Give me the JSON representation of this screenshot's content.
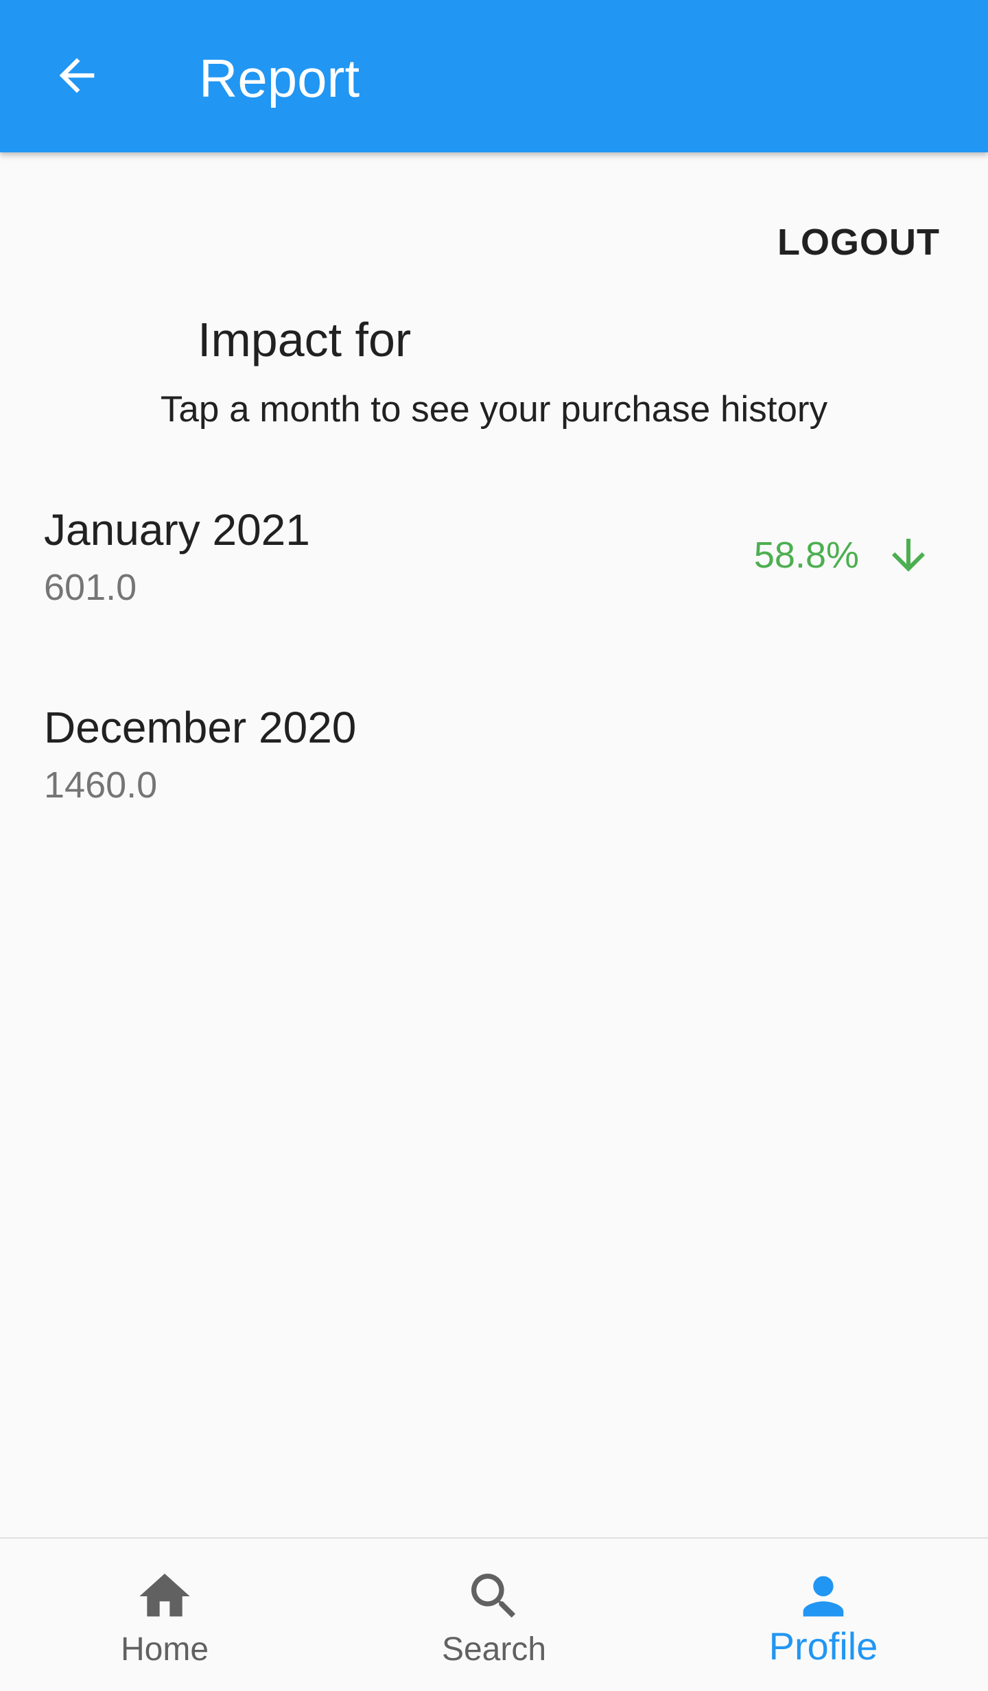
{
  "appbar": {
    "title": "Report",
    "back_icon": "arrow-back-icon",
    "color": "#2196f3"
  },
  "logout_label": "LOGOUT",
  "impact": {
    "title": "Impact for",
    "subtitle": "Tap a month to see your purchase history"
  },
  "months": [
    {
      "name": "January 2021",
      "value": "601.0",
      "change": "58.8%",
      "change_direction": "down",
      "change_color": "#4caf50"
    },
    {
      "name": "December 2020",
      "value": "1460.0"
    }
  ],
  "bottom_nav": {
    "items": [
      {
        "label": "Home",
        "icon": "home-icon"
      },
      {
        "label": "Search",
        "icon": "search-icon"
      },
      {
        "label": "Profile",
        "icon": "person-icon",
        "active": true
      }
    ],
    "active_color": "#2196f3",
    "inactive_color": "#616161"
  }
}
